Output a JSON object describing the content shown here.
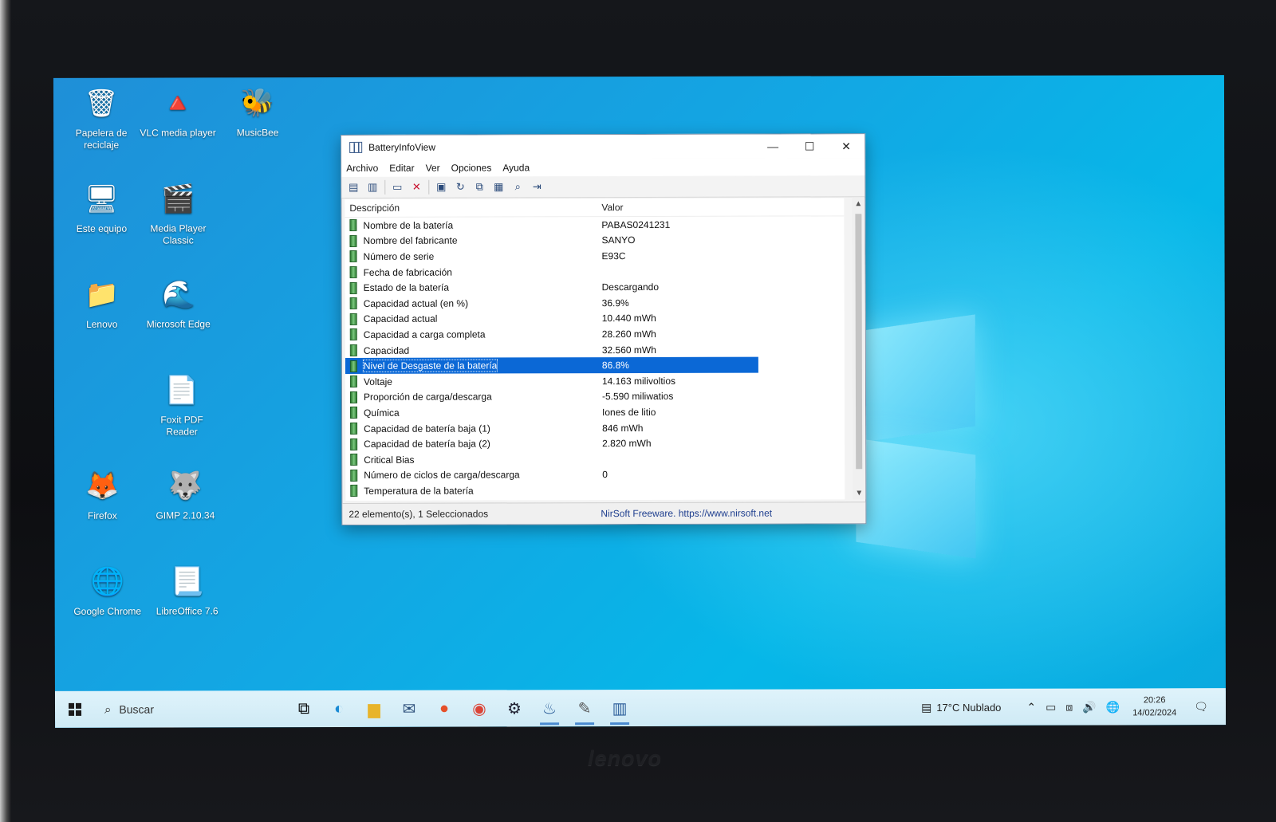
{
  "desktop_icons": [
    {
      "label": "Papelera de reciclaje",
      "icon": "recycle-bin-icon",
      "glyph": "🗑"
    },
    {
      "label": "VLC media player",
      "icon": "vlc-icon",
      "glyph": "🔺"
    },
    {
      "label": "MusicBee",
      "icon": "musicbee-icon",
      "glyph": "🐝"
    },
    {
      "label": "Este equipo",
      "icon": "computer-icon",
      "glyph": "🖥"
    },
    {
      "label": "Media Player Classic",
      "icon": "media-player-icon",
      "glyph": "🎬"
    },
    {
      "label": "Lenovo",
      "icon": "folder-icon",
      "glyph": "📁"
    },
    {
      "label": "Microsoft Edge",
      "icon": "edge-icon",
      "glyph": "🌊"
    },
    {
      "label": "Foxit PDF Reader",
      "icon": "foxit-icon",
      "glyph": "📄"
    },
    {
      "label": "Firefox",
      "icon": "firefox-icon",
      "glyph": "🦊"
    },
    {
      "label": "GIMP 2.10.34",
      "icon": "gimp-icon",
      "glyph": "🐺"
    },
    {
      "label": "Google Chrome",
      "icon": "chrome-icon",
      "glyph": "🌐"
    },
    {
      "label": "LibreOffice 7.6",
      "icon": "libreoffice-icon",
      "glyph": "📃"
    }
  ],
  "window": {
    "title": "BatteryInfoView",
    "menu": [
      "Archivo",
      "Editar",
      "Ver",
      "Opciones",
      "Ayuda"
    ],
    "columns": {
      "desc": "Descripción",
      "value": "Valor"
    },
    "rows": [
      {
        "desc": "Nombre de la batería",
        "value": "PABAS0241231"
      },
      {
        "desc": "Nombre del fabricante",
        "value": "SANYO"
      },
      {
        "desc": "Número de serie",
        "value": "E93C"
      },
      {
        "desc": "Fecha de fabricación",
        "value": ""
      },
      {
        "desc": "Estado de la batería",
        "value": "Descargando"
      },
      {
        "desc": "Capacidad actual (en %)",
        "value": "36.9%"
      },
      {
        "desc": "Capacidad actual",
        "value": "10.440 mWh"
      },
      {
        "desc": "Capacidad a carga completa",
        "value": "28.260 mWh"
      },
      {
        "desc": "Capacidad",
        "value": "32.560 mWh"
      },
      {
        "desc": "Nivel de Desgaste de la batería",
        "value": "86.8%",
        "selected": true
      },
      {
        "desc": "Voltaje",
        "value": "14.163 milivoltios"
      },
      {
        "desc": "Proporción de carga/descarga",
        "value": "-5.590 miliwatios"
      },
      {
        "desc": "Química",
        "value": "Iones de litio"
      },
      {
        "desc": "Capacidad de batería baja (1)",
        "value": "846 mWh"
      },
      {
        "desc": "Capacidad de batería baja (2)",
        "value": "2.820 mWh"
      },
      {
        "desc": "Critical Bias",
        "value": ""
      },
      {
        "desc": "Número de ciclos de carga/descarga",
        "value": "0"
      },
      {
        "desc": "Temperatura de la batería",
        "value": ""
      }
    ],
    "status_left": "22 elemento(s), 1 Seleccionados",
    "status_right": "NirSoft Freeware. https://www.nirsoft.net"
  },
  "taskbar": {
    "search_placeholder": "Buscar",
    "weather": "17°C  Nublado",
    "time": "20:26",
    "date": "14/02/2024"
  },
  "brand": "lenovo"
}
